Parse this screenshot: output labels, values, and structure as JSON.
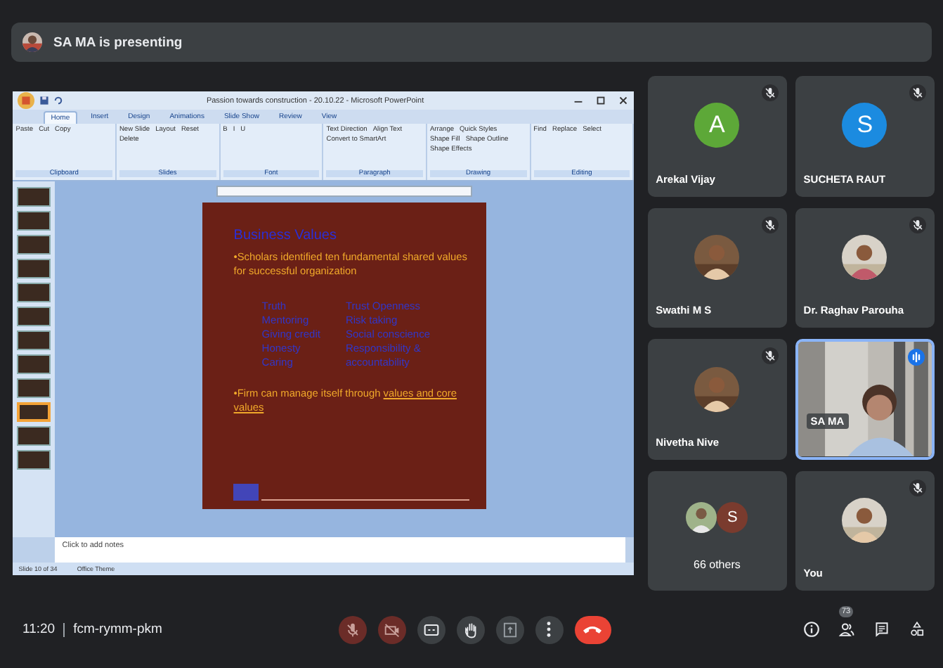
{
  "presenting_bar": {
    "text": "SA MA is presenting"
  },
  "powerpoint": {
    "title": "Passion towards construction - 20.10.22 - Microsoft PowerPoint",
    "tabs": [
      {
        "label": "Home",
        "selected": true
      },
      {
        "label": "Insert",
        "selected": false
      },
      {
        "label": "Design",
        "selected": false
      },
      {
        "label": "Animations",
        "selected": false
      },
      {
        "label": "Slide Show",
        "selected": false
      },
      {
        "label": "Review",
        "selected": false
      },
      {
        "label": "View",
        "selected": false
      }
    ],
    "ribbon_groups": [
      {
        "label": "Clipboard",
        "buttons": [
          "Paste",
          "Cut",
          "Copy"
        ]
      },
      {
        "label": "Slides",
        "buttons": [
          "New Slide",
          "Layout",
          "Reset",
          "Delete"
        ]
      },
      {
        "label": "Font",
        "buttons": [
          "B",
          "I",
          "U"
        ]
      },
      {
        "label": "Paragraph",
        "buttons": [
          "Text Direction",
          "Align Text",
          "Convert to SmartArt"
        ]
      },
      {
        "label": "Drawing",
        "buttons": [
          "Arrange",
          "Quick Styles",
          "Shape Fill",
          "Shape Outline",
          "Shape Effects"
        ]
      },
      {
        "label": "Editing",
        "buttons": [
          "Find",
          "Replace",
          "Select"
        ]
      }
    ],
    "thumbnails": [
      {
        "selected": false
      },
      {
        "selected": false
      },
      {
        "selected": false
      },
      {
        "selected": false
      },
      {
        "selected": false
      },
      {
        "selected": false
      },
      {
        "selected": false
      },
      {
        "selected": false
      },
      {
        "selected": false
      },
      {
        "selected": true
      },
      {
        "selected": false
      },
      {
        "selected": false
      }
    ],
    "slide": {
      "title": "Business Values",
      "bullet_1": "•Scholars identified ten fundamental shared values for successful organization",
      "columns": [
        [
          "Truth",
          "Mentoring",
          "Giving credit",
          "Honesty",
          "Caring"
        ],
        [
          "Trust Openness",
          "Risk taking",
          "Social conscience",
          "Responsibility &",
          "accountability"
        ]
      ],
      "bullet_2": "•Firm can manage itself through",
      "bullet_2_underlined": "values and core values"
    },
    "notes_placeholder": "Click to add notes",
    "status_bar": [
      "Slide 10 of 34",
      "Office Theme"
    ]
  },
  "participants": [
    {
      "name": "Arekal Vijay",
      "kind": "avatar",
      "initial": "A",
      "color": "#5da838",
      "muted": true,
      "speaking": false
    },
    {
      "name": "SUCHETA RAUT",
      "kind": "avatar",
      "initial": "S",
      "color": "#1b8be0",
      "muted": true,
      "speaking": false
    },
    {
      "name": "Swathi M S",
      "muted": true,
      "speaking": false
    },
    {
      "name": "Dr. Raghav Parouha",
      "muted": true,
      "speaking": false
    },
    {
      "name": "Nivetha Nive",
      "muted": true,
      "speaking": false
    },
    {
      "name": "SA MA",
      "kind": "video",
      "muted": false,
      "speaking": true
    },
    {
      "name": "66 others",
      "kind": "others",
      "initial": "S",
      "color": "#7a3b2e",
      "muted": false,
      "speaking": false
    },
    {
      "name": "You",
      "muted": true,
      "speaking": false
    }
  ],
  "bottom_bar": {
    "time": "11:20",
    "meeting_code": "fcm-rymm-pkm",
    "controls": [
      {
        "kind": "mic",
        "on": false
      },
      {
        "kind": "camera",
        "on": false
      },
      {
        "kind": "captions"
      },
      {
        "kind": "hand"
      },
      {
        "kind": "present"
      },
      {
        "kind": "more"
      },
      {
        "kind": "end"
      }
    ],
    "people_count": "73"
  }
}
